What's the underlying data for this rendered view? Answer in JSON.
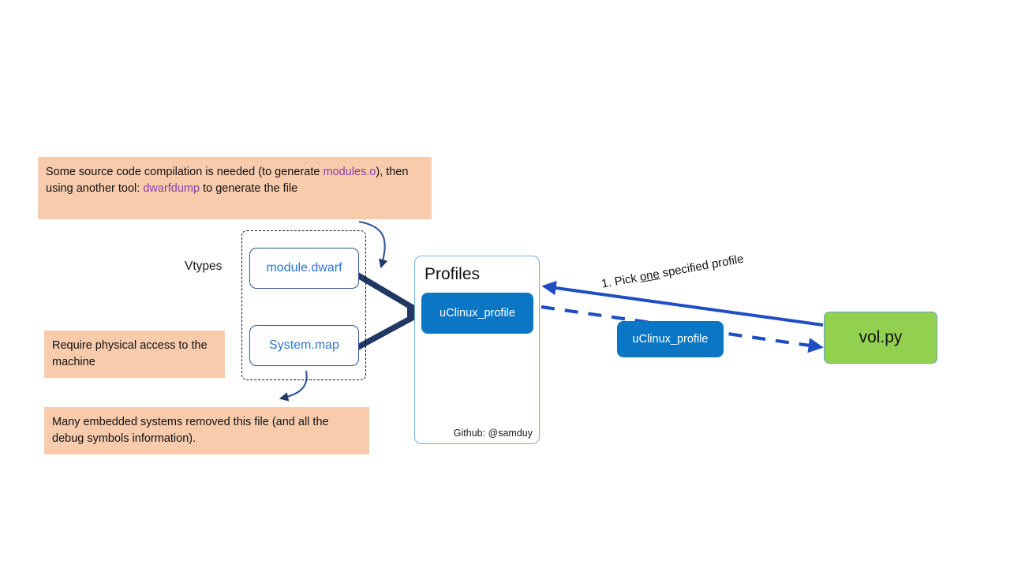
{
  "notes": {
    "compile": {
      "part1": "Some source code compilation is needed (to generate ",
      "accent1": "modules.o",
      "part2": "), then using another tool: ",
      "accent2": "dwarfdump",
      "part3": " to generate the file"
    },
    "physical_access": "Require physical access to the machine",
    "removed_file": "Many embedded systems removed this file (and all the debug symbols information)."
  },
  "vtypes": {
    "label": "Vtypes",
    "files": [
      {
        "name": "module.dwarf"
      },
      {
        "name": "System.map"
      }
    ]
  },
  "profiles": {
    "title": "Profiles",
    "chip_label": "uClinux_profile",
    "footer": "Github: @samduy"
  },
  "selected_profile": {
    "label": "uClinux_profile"
  },
  "tool": {
    "label": "vol.py"
  },
  "arrows": {
    "pick_one": {
      "prefix": "1. Pick ",
      "emphasis": "one",
      "suffix": " specified profile"
    }
  },
  "colors": {
    "note_bg": "#f8cbad",
    "note_accent": "#8b3fa8",
    "profile_blue": "#0b77c4",
    "tool_green": "#92d050",
    "thick_arrow_navy": "#1f3864",
    "bright_blue_arrow": "#1f4ec4",
    "file_border": "#2f5597",
    "file_text": "#2e75d4",
    "panel_border": "#73b0d8"
  }
}
